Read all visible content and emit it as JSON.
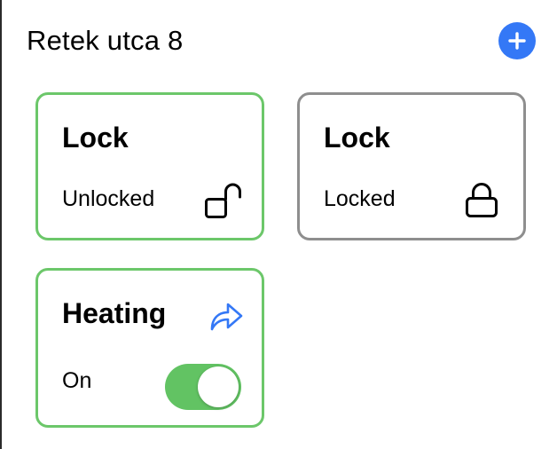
{
  "header": {
    "title": "Retek utca 8",
    "add_icon": "plus-circle-icon"
  },
  "colors": {
    "accent": "#3478f6",
    "active_border": "#6cc76a",
    "inactive_border": "#8e8e8e",
    "toggle_on": "#62c363"
  },
  "cards": [
    {
      "title": "Lock",
      "status": "Unlocked",
      "icon": "lock-open-icon",
      "state": "active"
    },
    {
      "title": "Lock",
      "status": "Locked",
      "icon": "lock-closed-icon",
      "state": "inactive"
    },
    {
      "title": "Heating",
      "status": "On",
      "icon": "share-arrow-icon",
      "toggle_on": true,
      "state": "active"
    }
  ]
}
